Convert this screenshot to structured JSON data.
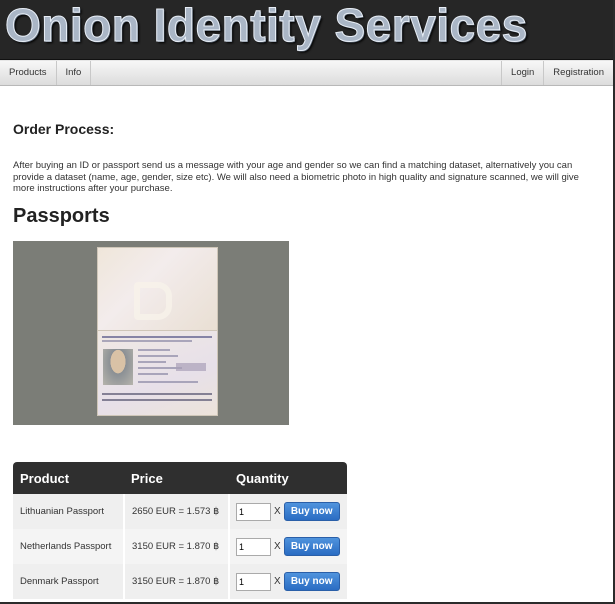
{
  "banner": {
    "title": "Onion Identity Services"
  },
  "nav": {
    "left": [
      {
        "label": "Products"
      },
      {
        "label": "Info"
      }
    ],
    "right": [
      {
        "label": "Login"
      },
      {
        "label": "Registration"
      }
    ]
  },
  "order": {
    "heading": "Order Process:",
    "text": "After buying an ID or passport send us a message with your age and gender so we can find a matching dataset, alternatively you can provide a dataset (name, age, gender, size etc). We will also need a biometric photo in high quality and signature scanned, we will give more instructions after your purchase."
  },
  "passports": {
    "heading": "Passports"
  },
  "table": {
    "headers": {
      "product": "Product",
      "price": "Price",
      "quantity": "Quantity"
    },
    "rows": [
      {
        "product": "Lithuanian Passport",
        "price": "2650 EUR = 1.573 ฿",
        "qty": "1"
      },
      {
        "product": "Netherlands Passport",
        "price": "3150 EUR = 1.870 ฿",
        "qty": "1"
      },
      {
        "product": "Denmark Passport",
        "price": "3150 EUR = 1.870 ฿",
        "qty": "1"
      }
    ],
    "times_symbol": "X",
    "buy_label": "Buy now"
  }
}
